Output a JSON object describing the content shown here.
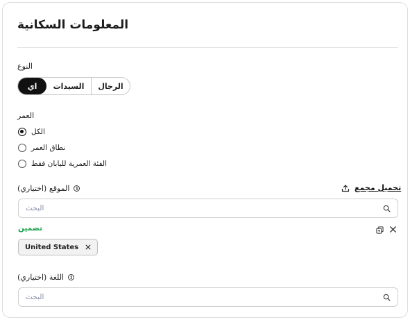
{
  "title": "المعلومات السكانية",
  "gender": {
    "label": "النوع",
    "options": [
      "اي",
      "السيدات",
      "الرجال"
    ],
    "selected": "اي"
  },
  "age": {
    "label": "العمر",
    "options": [
      "الكل",
      "نطاق العمر",
      "الفئة العمرية لليابان فقط"
    ],
    "selected": "الكل"
  },
  "location": {
    "label": "الموقع (اختياري)",
    "bulk_upload": "تحميل مجمع",
    "search_placeholder": "البحث",
    "include_label": "تضمين",
    "chips": [
      "United States"
    ]
  },
  "language": {
    "label": "اللغة (اختياري)",
    "search_placeholder": "البحث"
  },
  "icons": {
    "info": "info-icon",
    "upload": "upload-icon",
    "search": "search-icon",
    "copy": "copy-icon",
    "close": "close-icon"
  },
  "colors": {
    "include": "#16a34a",
    "segment_active": "#111111"
  }
}
